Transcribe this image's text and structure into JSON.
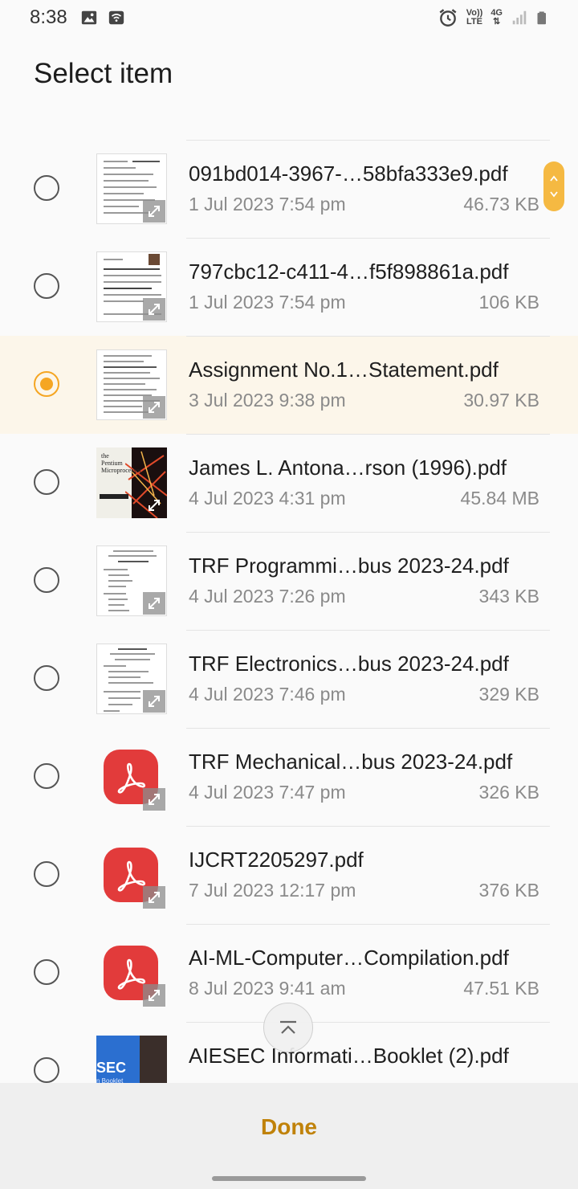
{
  "status": {
    "time": "8:38",
    "volte": "Vo))",
    "lte": "LTE",
    "network": "4G"
  },
  "title": "Select item",
  "files": [
    {
      "name": "091bd014-3967-…58bfa333e9.pdf",
      "date": "1 Jul 2023 7:54 pm",
      "size": "46.73 KB",
      "thumb": "document",
      "selected": false
    },
    {
      "name": "797cbc12-c411-4…f5f898861a.pdf",
      "date": "1 Jul 2023 7:54 pm",
      "size": "106 KB",
      "thumb": "document",
      "selected": false
    },
    {
      "name": "Assignment No.1…Statement.pdf",
      "date": "3 Jul 2023 9:38 pm",
      "size": "30.97 KB",
      "thumb": "document",
      "selected": true
    },
    {
      "name": "James L. Antona…rson (1996).pdf",
      "date": "4 Jul 2023 4:31 pm",
      "size": "45.84 MB",
      "thumb": "book-cover",
      "selected": false
    },
    {
      "name": "TRF Programmi…bus 2023-24.pdf",
      "date": "4 Jul 2023 7:26 pm",
      "size": "343 KB",
      "thumb": "document",
      "selected": false
    },
    {
      "name": "TRF Electronics…bus 2023-24.pdf",
      "date": "4 Jul 2023 7:46 pm",
      "size": "329 KB",
      "thumb": "document",
      "selected": false
    },
    {
      "name": "TRF Mechanical…bus 2023-24.pdf",
      "date": "4 Jul 2023 7:47 pm",
      "size": "326 KB",
      "thumb": "pdf-icon",
      "selected": false
    },
    {
      "name": "IJCRT2205297.pdf",
      "date": "7 Jul 2023 12:17 pm",
      "size": "376 KB",
      "thumb": "pdf-icon",
      "selected": false
    },
    {
      "name": "AI-ML-Computer…Compilation.pdf",
      "date": "8 Jul 2023 9:41 am",
      "size": "47.51 KB",
      "thumb": "pdf-icon",
      "selected": false
    },
    {
      "name": "AIESEC Informati…Booklet (2).pdf",
      "date": "",
      "size": "",
      "thumb": "aiesec-cover",
      "selected": false
    }
  ],
  "book_cover": {
    "line1": "the",
    "line2": "Pentium",
    "line3": "Microprocessor"
  },
  "aiesec_cover": {
    "text": "SEC",
    "subtext": "n Booklet"
  },
  "done_label": "Done",
  "colors": {
    "accent": "#f5a623",
    "done": "#c0820a",
    "pdf_red": "#e23b3b",
    "selected_bg": "#fcf6ea"
  }
}
